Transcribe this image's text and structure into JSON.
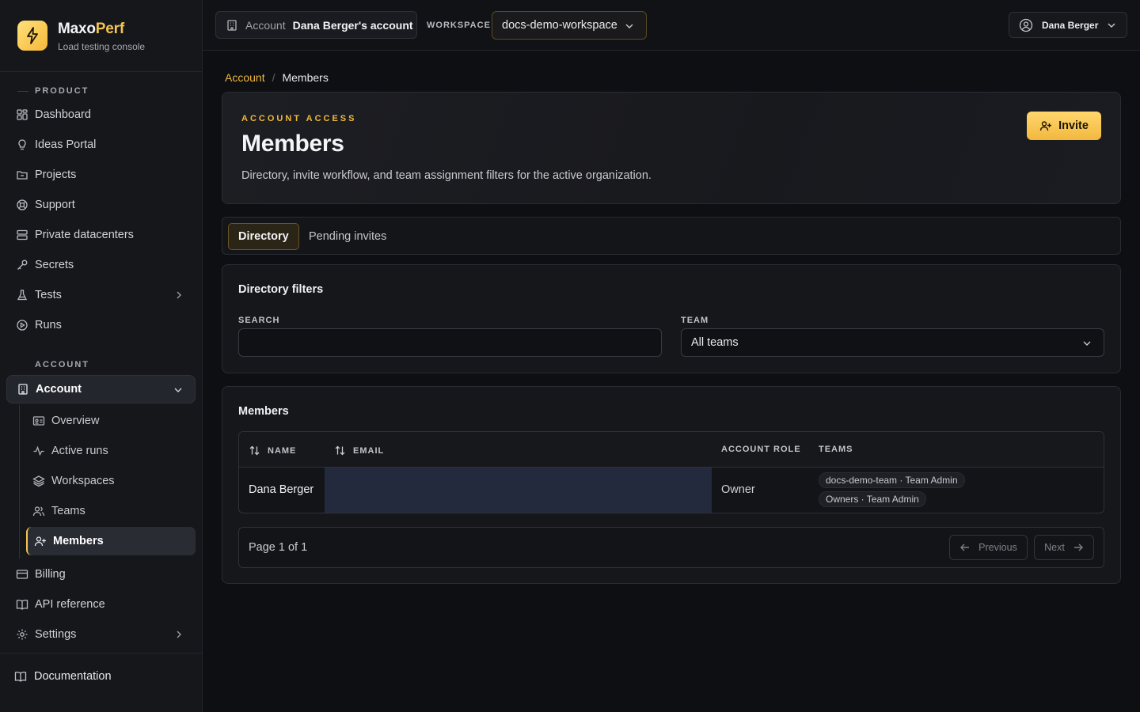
{
  "brand": {
    "name_main": "Maxo",
    "name_accent": "Perf",
    "subtitle": "Load testing console",
    "accent_color": "#f5c451"
  },
  "sidebar": {
    "product_label": "PRODUCT",
    "product_items": [
      {
        "label": "Dashboard",
        "icon": "dashboard-icon"
      },
      {
        "label": "Ideas Portal",
        "icon": "lightbulb-icon"
      },
      {
        "label": "Projects",
        "icon": "folder-icon"
      },
      {
        "label": "Support",
        "icon": "lifebuoy-icon"
      },
      {
        "label": "Private datacenters",
        "icon": "server-icon"
      },
      {
        "label": "Secrets",
        "icon": "key-icon"
      },
      {
        "label": "Tests",
        "icon": "flask-icon"
      },
      {
        "label": "Runs",
        "icon": "play-circle-icon"
      }
    ],
    "account_label": "ACCOUNT",
    "account_parent": "Account",
    "account_children": [
      {
        "label": "Overview",
        "icon": "id-card-icon"
      },
      {
        "label": "Active runs",
        "icon": "activity-icon"
      },
      {
        "label": "Workspaces",
        "icon": "layers-icon"
      },
      {
        "label": "Teams",
        "icon": "users-icon"
      },
      {
        "label": "Members",
        "icon": "user-plus-icon"
      }
    ],
    "bottom_items": [
      {
        "label": "Billing",
        "icon": "credit-card-icon"
      },
      {
        "label": "API reference",
        "icon": "book-icon"
      },
      {
        "label": "Settings",
        "icon": "gear-icon"
      }
    ],
    "footer_link": "Documentation"
  },
  "topbar": {
    "account_label": "Account",
    "account_value": "Dana Berger's account",
    "workspace_label": "WORKSPACE",
    "workspace_value": "docs-demo-workspace",
    "user_name": "Dana Berger"
  },
  "breadcrumb": {
    "parent": "Account",
    "separator": "/",
    "current": "Members"
  },
  "hero": {
    "eyebrow": "ACCOUNT ACCESS",
    "title": "Members",
    "description": "Directory, invite workflow, and team assignment filters for the active organization.",
    "invite_label": "Invite"
  },
  "tabs": [
    {
      "label": "Directory"
    },
    {
      "label": "Pending invites"
    }
  ],
  "filters": {
    "title": "Directory filters",
    "search_label": "SEARCH",
    "search_value": "",
    "team_label": "TEAM",
    "team_value": "All teams"
  },
  "members": {
    "title": "Members",
    "columns": {
      "name": "NAME",
      "email": "EMAIL",
      "role": "ACCOUNT ROLE",
      "teams": "TEAMS"
    },
    "rows": [
      {
        "name": "Dana Berger",
        "email": "",
        "role": "Owner",
        "teams": [
          "docs-demo-team · Team Admin",
          "Owners · Team Admin"
        ]
      }
    ],
    "pager": {
      "text": "Page 1 of 1",
      "prev": "Previous",
      "next": "Next"
    }
  }
}
